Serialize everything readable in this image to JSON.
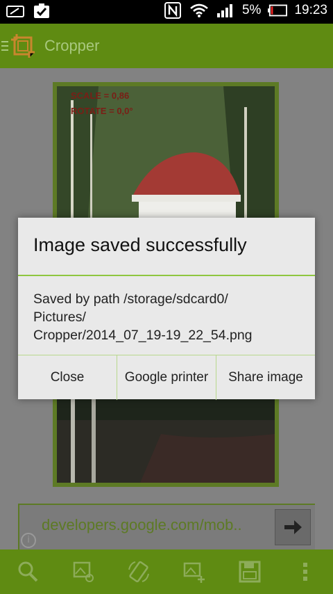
{
  "status_bar": {
    "battery": "5%",
    "time": "19:23",
    "icons": [
      "sd-card-icon",
      "task-done-icon",
      "nfc-icon",
      "wifi-icon",
      "signal-icon",
      "battery-icon"
    ]
  },
  "action_bar": {
    "title": "Cropper",
    "icons": [
      "menu-icon",
      "app-logo-icon"
    ]
  },
  "photo": {
    "scale_text": "SCALE = 0,86",
    "rotate_text": "ROTATE = 0,0°"
  },
  "address_bar": {
    "url": "developers.google.com/mob..",
    "go_icon": "arrow-right-icon"
  },
  "bottom_toolbar": {
    "icons": [
      "zoom-icon",
      "image-edit-icon",
      "rotate-screen-icon",
      "add-image-icon",
      "save-icon",
      "overflow-menu-icon"
    ]
  },
  "dialog": {
    "title": "Image saved successfully",
    "message_lines": [
      "Saved by path /storage/sdcard0/",
      "Pictures/",
      "Cropper/2014_07_19-19_22_54.png"
    ],
    "buttons": [
      "Close",
      "Google printer",
      "Share image"
    ]
  },
  "colors": {
    "accent": "#5f8b12",
    "divider": "#8ec63f",
    "dialog_bg": "#e9e9e9"
  }
}
